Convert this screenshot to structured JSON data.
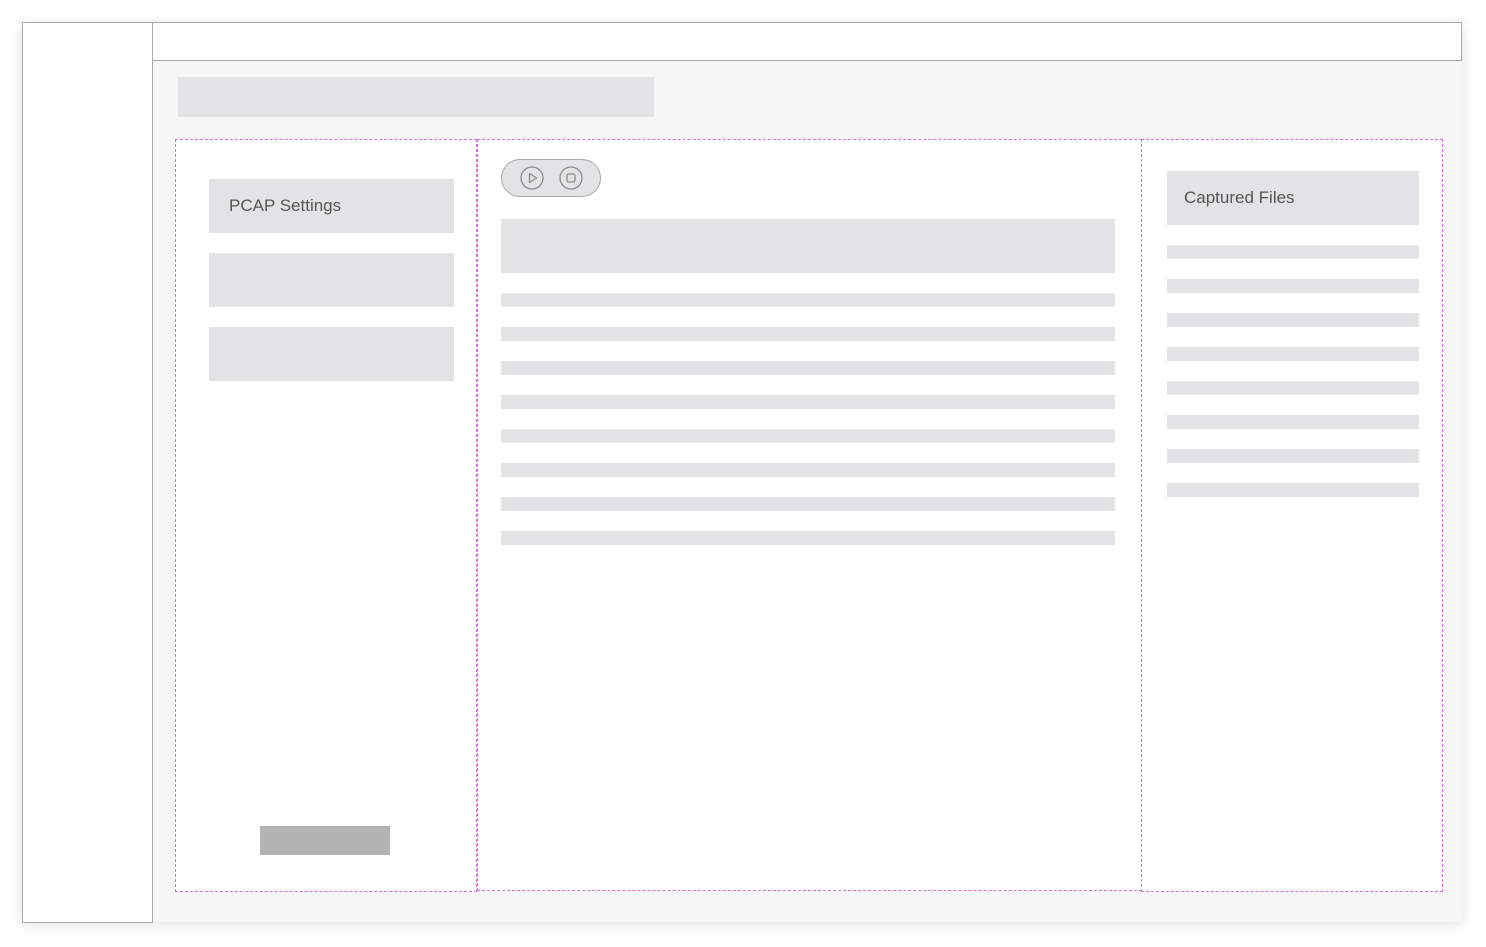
{
  "settings_panel": {
    "items": [
      {
        "label": "PCAP Settings"
      },
      {
        "label": ""
      },
      {
        "label": ""
      }
    ]
  },
  "captured_panel": {
    "title": "Captured Files"
  },
  "controls": {
    "play_icon": "play-icon",
    "stop_icon": "stop-icon"
  },
  "colors": {
    "panel_border": "#d86be0",
    "placeholder": "#e2e3e4",
    "button": "#b3b3b3",
    "text": "#555555"
  }
}
